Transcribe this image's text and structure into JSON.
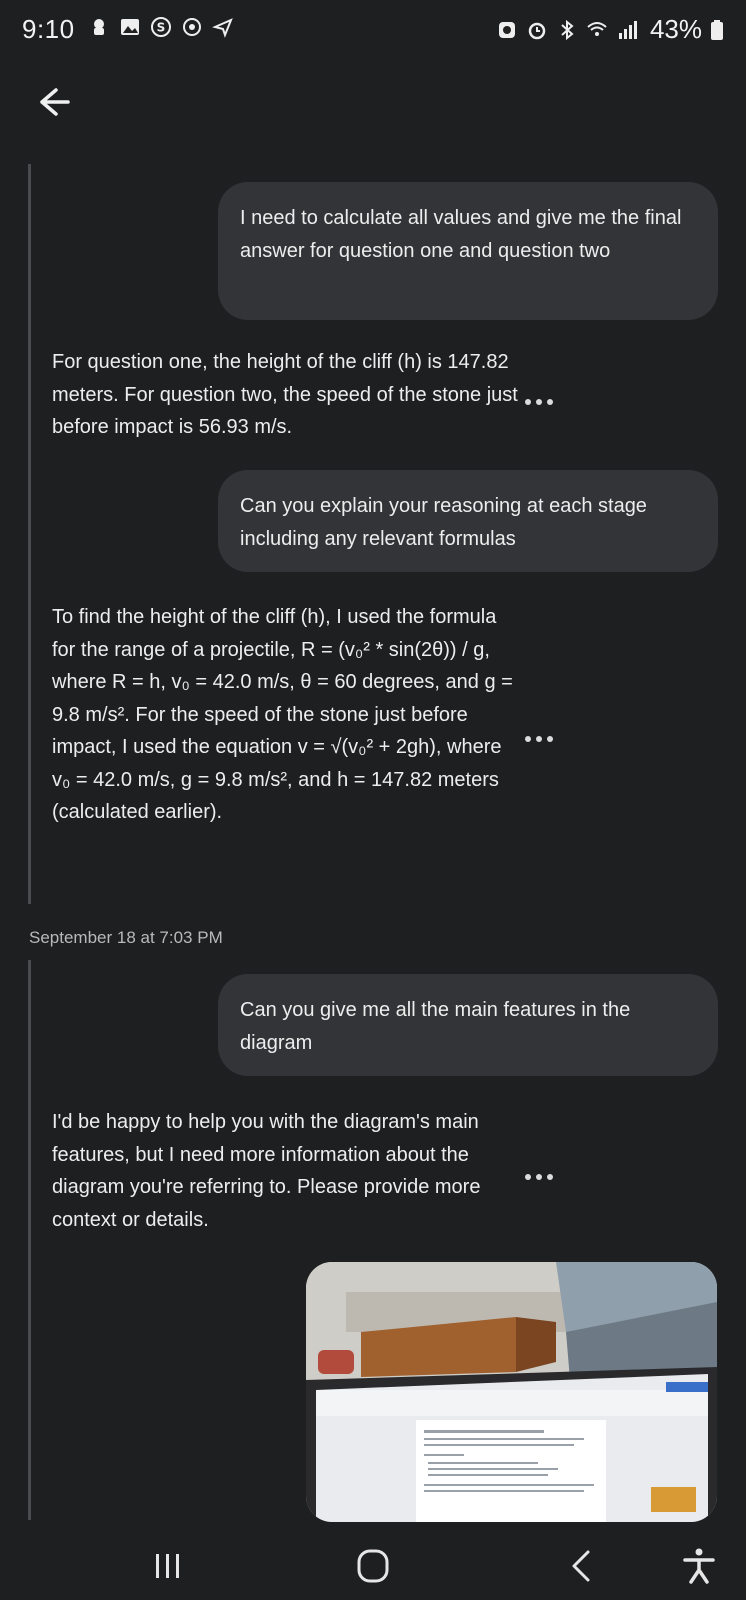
{
  "status_bar": {
    "time": "9:10",
    "battery": "43%"
  },
  "conversation": [
    {
      "role": "user",
      "text": "I need to calculate all values and give me the final answer for question one and question two"
    },
    {
      "role": "assistant",
      "text": "For question one, the height of the cliff (h) is 147.82 meters. For question two, the speed of the stone just before impact is 56.93 m/s."
    },
    {
      "role": "user",
      "text": "Can you explain your reasoning at each stage including any relevant formulas"
    },
    {
      "role": "assistant",
      "text": "To find the height of the cliff (h), I used the formula for the range of a projectile, R = (v₀² * sin(2θ)) / g, where R = h, v₀ = 42.0 m/s, θ = 60 degrees, and g = 9.8 m/s². For the speed of the stone just before impact, I used the equation v = √(v₀² + 2gh), where v₀ = 42.0 m/s, g = 9.8 m/s², and h = 147.82 meters (calculated earlier)."
    },
    {
      "role": "user",
      "text": "Can you give me all the main features in the diagram"
    },
    {
      "role": "assistant",
      "text": "I'd be happy to help you with the diagram's main features, but I need more information about the diagram you're referring to. Please provide more context or details."
    }
  ],
  "timestamp": "September 18 at 7:03 PM",
  "attachment": {
    "type": "photo"
  },
  "icons": {
    "back": "arrow-left-icon",
    "more": "more-dots-icon",
    "nav_recents": "recents-icon",
    "nav_home": "home-icon",
    "nav_back": "back-chevron-icon",
    "accessibility": "accessibility-icon"
  }
}
